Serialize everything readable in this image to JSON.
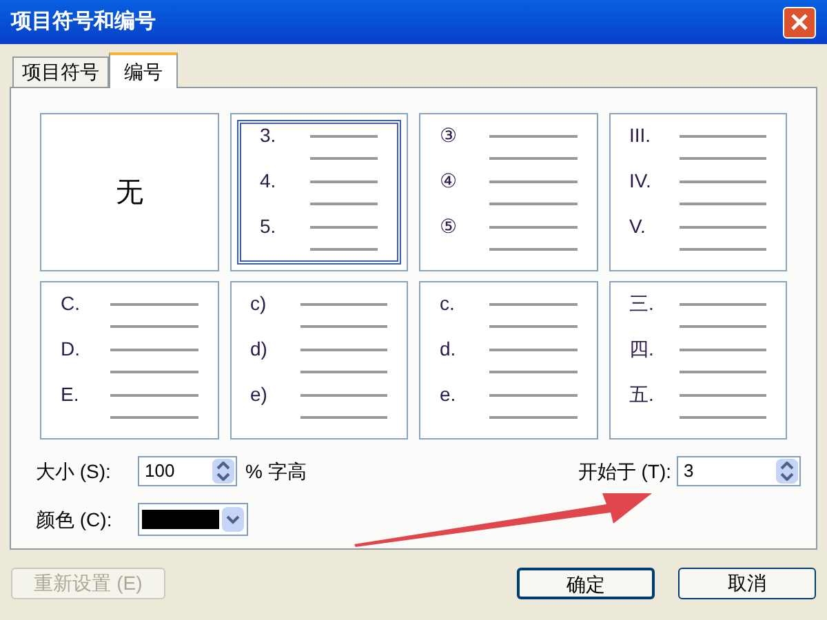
{
  "window": {
    "title": "项目符号和编号"
  },
  "tabs": [
    {
      "label": "项目符号",
      "selected": false
    },
    {
      "label": "编号",
      "selected": true
    }
  ],
  "tiles": [
    {
      "kind": "none",
      "label": "无",
      "selected": false
    },
    {
      "kind": "list",
      "markers": [
        "3.",
        "4.",
        "5."
      ],
      "selected": true
    },
    {
      "kind": "list",
      "markers": [
        "③",
        "④",
        "⑤"
      ],
      "selected": false
    },
    {
      "kind": "list",
      "markers": [
        "III.",
        "IV.",
        "V."
      ],
      "selected": false
    },
    {
      "kind": "list",
      "markers": [
        "C.",
        "D.",
        "E."
      ],
      "selected": false
    },
    {
      "kind": "list",
      "markers": [
        "c)",
        "d)",
        "e)"
      ],
      "selected": false
    },
    {
      "kind": "list",
      "markers": [
        "c.",
        "d.",
        "e."
      ],
      "selected": false
    },
    {
      "kind": "list",
      "markers": [
        "三.",
        "四.",
        "五."
      ],
      "selected": false
    }
  ],
  "size": {
    "label": "大小 (S):",
    "value": "100",
    "unit": "% 字高"
  },
  "start": {
    "label": "开始于 (T):",
    "value": "3"
  },
  "color": {
    "label": "颜色 (C):",
    "color": "#000000"
  },
  "buttons": [
    {
      "label": "重新设置 (E)",
      "disabled": true
    },
    {
      "label": "确定",
      "disabled": false,
      "default": true
    },
    {
      "label": "取消",
      "disabled": false,
      "default": false
    }
  ]
}
